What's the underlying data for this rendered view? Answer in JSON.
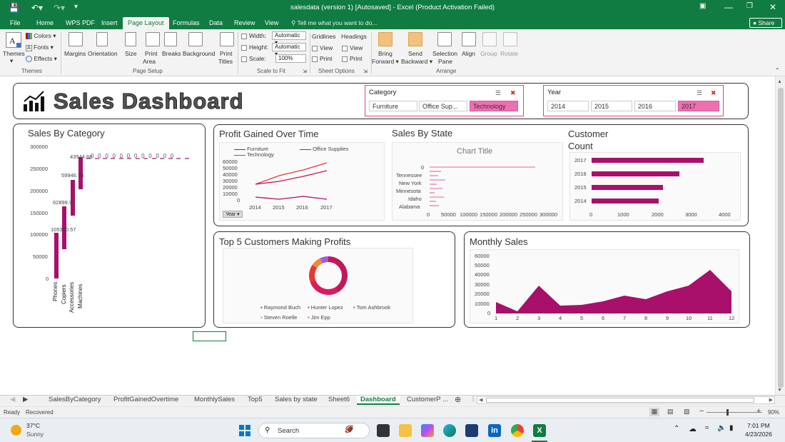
{
  "titlebar": {
    "title": "salesdata (version 1) [Autosaved] - Excel (Product Activation Failed)",
    "undo_icon": "undo-icon",
    "redo_icon": "redo-icon"
  },
  "tabs": [
    "File",
    "Home",
    "WPS PDF",
    "Insert",
    "Page Layout",
    "Formulas",
    "Data",
    "Review",
    "View"
  ],
  "active_tab": "Page Layout",
  "tell_me": "Tell me what you want to do...",
  "share": "Share",
  "ribbon": {
    "themes": {
      "themes": "Themes",
      "colors": "Colors",
      "fonts": "Fonts",
      "effects": "Effects",
      "group": "Themes"
    },
    "page_setup": {
      "margins": "Margins",
      "orientation": "Orientation",
      "size": "Size",
      "print_area": "Print Area",
      "print_area_1": "Print",
      "print_area_2": "Area",
      "breaks": "Breaks",
      "background": "Background",
      "print_titles_1": "Print",
      "print_titles_2": "Titles",
      "group": "Page Setup"
    },
    "scale": {
      "width_label": "Width:",
      "width_value": "Automatic",
      "height_label": "Height:",
      "height_value": "Automatic",
      "scale_label": "Scale:",
      "scale_value": "100%",
      "group": "Scale to Fit"
    },
    "sheet_options": {
      "gridlines": "Gridlines",
      "headings": "Headings",
      "view": "View",
      "print": "Print",
      "group": "Sheet Options"
    },
    "arrange": {
      "bring_1": "Bring",
      "bring_2": "Forward",
      "send_1": "Send",
      "send_2": "Backward",
      "sel_1": "Selection",
      "sel_2": "Pane",
      "align": "Align",
      "group_btn": "Group",
      "rotate": "Rotate",
      "group": "Arrange"
    }
  },
  "dashboard": {
    "title": "Sales Dashboard",
    "category_slicer": {
      "header": "Category",
      "items": [
        "Furniture",
        "Office Sup...",
        "Technology"
      ],
      "selected": "Technology"
    },
    "year_slicer": {
      "header": "Year",
      "items": [
        "2014",
        "2015",
        "2016",
        "2017"
      ],
      "selected": "2017"
    },
    "sales_by_category": {
      "title": "Sales By Category",
      "y_ticks": [
        "300000",
        "250000",
        "200000",
        "150000",
        "100000",
        "50000",
        "0"
      ],
      "data_labels": [
        "105340.57",
        "62899.96",
        "59946.76",
        "43544.68"
      ],
      "categories": [
        "Phones",
        "Copiers",
        "Accessories",
        "Machines"
      ],
      "zero_labels": [
        "0",
        "0",
        "0",
        "0",
        "0",
        "0",
        "0",
        "0",
        "0",
        "0",
        "0",
        "0"
      ]
    },
    "profit_over_time": {
      "title": "Profit Gained Over Time",
      "legend": [
        "Furniture",
        "Office Supplies",
        "Technology"
      ],
      "y_ticks": [
        "60000",
        "50000",
        "40000",
        "30000",
        "20000",
        "10000",
        "0"
      ],
      "x_ticks": [
        "2014",
        "2015",
        "2016",
        "2017"
      ],
      "field_button": "Year"
    },
    "sales_by_state": {
      "title": "Sales By State",
      "chart_title": "Chart Title",
      "y_labels": [
        "0",
        "Tennessee",
        "New York",
        "Minnesota",
        "Idaho",
        "Alabama"
      ],
      "x_ticks": [
        "0",
        "50000",
        "100000",
        "150000",
        "200000",
        "250000",
        "300000"
      ]
    },
    "customer_count": {
      "title_1": "Customer",
      "title_2": "Count",
      "y_labels": [
        "2017",
        "2016",
        "2015",
        "2014"
      ],
      "x_ticks": [
        "0",
        "1000",
        "2000",
        "3000",
        "4000"
      ]
    },
    "top5": {
      "title": "Top 5 Customers Making Profits",
      "legend": [
        "Raymond Buch",
        "Hunter Lopez",
        "Tom Ashbrook",
        "Steven Roelle",
        "Jim Epp"
      ]
    },
    "monthly_sales": {
      "title": "Monthly Sales",
      "y_ticks": [
        "60000",
        "50000",
        "40000",
        "30000",
        "20000",
        "10000",
        "0"
      ],
      "x_ticks": [
        "1",
        "2",
        "3",
        "4",
        "5",
        "6",
        "7",
        "8",
        "9",
        "10",
        "11",
        "12"
      ]
    }
  },
  "sheet_tabs": [
    "SalesByCategory",
    "ProfitGainedOvertime",
    "MonthlySales",
    "Top5",
    "Sales by state",
    "Sheet6",
    "Dashboard",
    "CustomerP ..."
  ],
  "active_sheet": "Dashboard",
  "status": {
    "ready": "Ready",
    "recovered": "Recovered",
    "zoom": "90%"
  },
  "taskbar": {
    "temp": "37°C",
    "weather": "Sunny",
    "search": "Search",
    "time": "7:01 PM",
    "date": "4/23/2026"
  },
  "colors": {
    "excel_green": "#107c41",
    "accent": "#a8106b",
    "slicer_selected": "#ee6fb2"
  }
}
